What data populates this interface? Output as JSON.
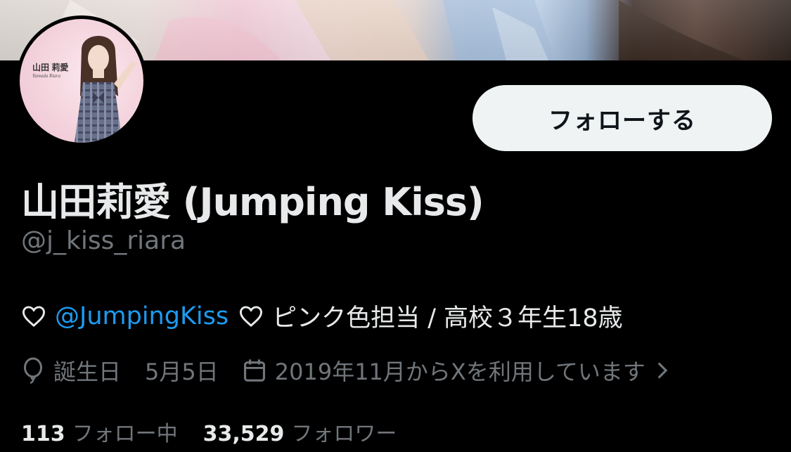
{
  "profile": {
    "follow_label": "フォローする",
    "display_name": "山田莉愛 (Jumping Kiss)",
    "handle": "@j_kiss_riara",
    "avatar": {
      "name_text": "山田 莉愛",
      "romaji_text": "Yamada Riara"
    }
  },
  "bio": {
    "mention": "@JumpingKiss",
    "text": "ピンク色担当 / 高校３年生18歳"
  },
  "meta": {
    "birthday_label": "誕生日",
    "birthday_value": "5月5日",
    "joined_text": "2019年11月からXを利用しています"
  },
  "stats": {
    "following_count": "113",
    "following_label": "フォロー中",
    "followers_count": "33,529",
    "followers_label": "フォロワー"
  },
  "colors": {
    "background": "#000000",
    "text_primary": "#e7e9ea",
    "text_secondary": "#71767b",
    "link": "#1d9bf0",
    "button_bg": "#eff3f4"
  },
  "icons": [
    "heart-icon",
    "balloon-icon",
    "calendar-icon",
    "chevron-right-icon"
  ]
}
